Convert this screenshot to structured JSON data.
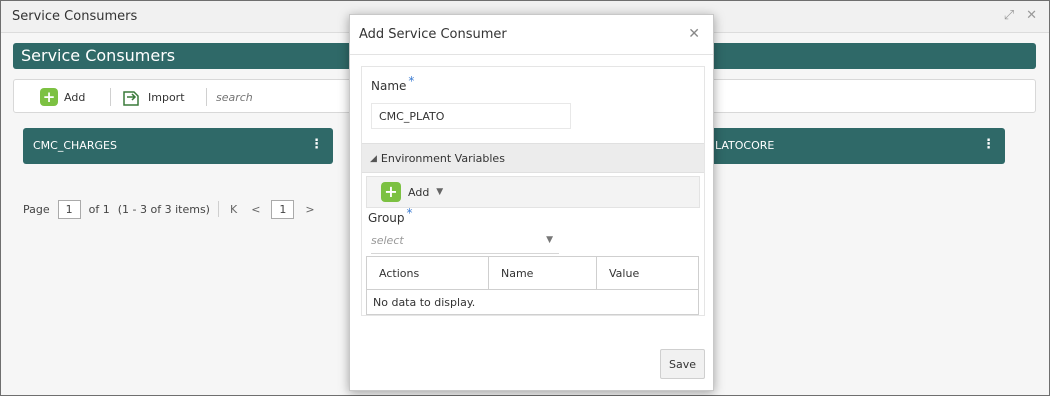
{
  "window": {
    "title": "Service Consumers"
  },
  "page": {
    "section_title": "Service Consumers"
  },
  "toolbar": {
    "add_label": "Add",
    "import_label": "Import",
    "search_placeholder": "search"
  },
  "cards": [
    {
      "label": "CMC_CHARGES"
    },
    {
      "label": "LATOCORE"
    }
  ],
  "pager": {
    "page_label": "Page",
    "current_page": "1",
    "of_label": "of 1",
    "range_text": "(1 - 3 of 3 items)",
    "first_glyph": "K",
    "prev_glyph": "<",
    "page_button": "1",
    "next_glyph": ">"
  },
  "modal": {
    "title": "Add Service Consumer",
    "name_label": "Name",
    "required_mark": "*",
    "name_value": "CMC_PLATO",
    "env_label": "Environment Variables",
    "env_add_label": "Add",
    "group_label": "Group",
    "group_placeholder": "select",
    "table": {
      "columns": [
        "Actions",
        "Name",
        "Value"
      ],
      "empty_text": "No data to display."
    },
    "save_label": "Save"
  },
  "icons": {
    "add": "plus-icon",
    "import": "import-icon",
    "close": "close-icon",
    "kebab": "kebab-icon",
    "collapse": "triangle-icon",
    "dropdown": "caret-down-icon"
  },
  "colors": {
    "accent": "#2f6968",
    "add_green": "#7cc142",
    "required": "#3b7bd1"
  }
}
